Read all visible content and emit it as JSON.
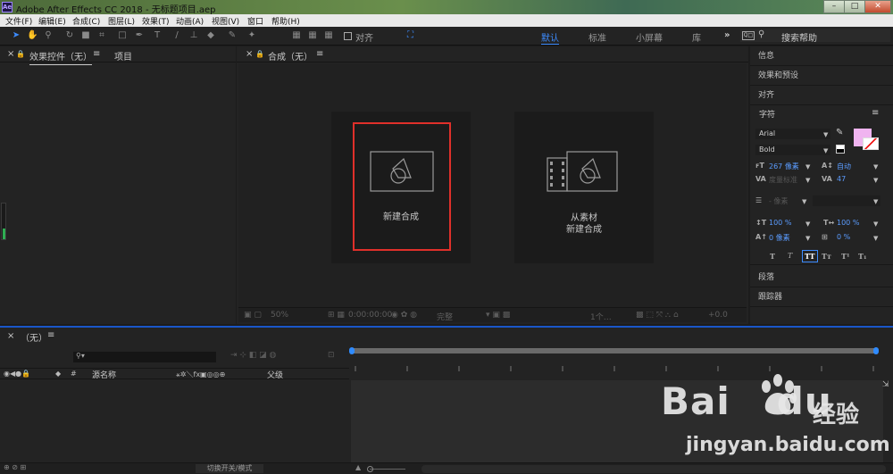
{
  "titlebar": {
    "logo": "Ae",
    "title": "Adobe After Effects CC 2018 - 无标题项目.aep",
    "buttons": [
      "–",
      "□",
      "✕"
    ]
  },
  "menu": [
    "文件(F)",
    "编辑(E)",
    "合成(C)",
    "图层(L)",
    "效果(T)",
    "动画(A)",
    "视图(V)",
    "窗口",
    "帮助(H)"
  ],
  "toolbar": {
    "align_label": "对齐",
    "workspaces": [
      "默认",
      "标准",
      "小屏幕",
      "库"
    ],
    "more": "»",
    "search_toggle": "Q□",
    "search_placeholder": "搜索帮助"
  },
  "left_panel": {
    "close": "×",
    "lock": "🔒",
    "tab_effects": "效果控件（无）",
    "menu": "≡",
    "tab_project": "项目"
  },
  "comp_panel": {
    "close": "×",
    "lock": "🔒",
    "tab_label": "合成（无）",
    "menu": "≡",
    "new_comp_label": "新建合成",
    "from_footage_line1": "从素材",
    "from_footage_line2": "新建合成",
    "footer": {
      "zoom": "50%",
      "timecode": "0:00:00:00",
      "quality": "完整",
      "views": "1个…",
      "exposure": "+0.0"
    }
  },
  "right_panel": {
    "sections_top": [
      "信息",
      "效果和预设",
      "对齐"
    ],
    "character_title": "字符",
    "character_menu": "≡",
    "font_name": "Arial",
    "font_style": "Bold",
    "font_size": "267 像素",
    "leading": "自动",
    "kerning": "度量标准",
    "tracking": "47",
    "stroke_width": "- 像素",
    "vscale": "100 %",
    "hscale": "100 %",
    "baseline": "0 像素",
    "tsume": "0 %",
    "styles": [
      "T",
      "T",
      "TT",
      "Tт",
      "T¹",
      "T₁"
    ],
    "sections_bottom": [
      "段落",
      "跟踪器"
    ],
    "fill_color": "#f0b4f0"
  },
  "timeline": {
    "close": "×",
    "title": "（无）",
    "menu": "≡",
    "search_icon": "⚲▾",
    "col_number": "#",
    "col_source": "源名称",
    "col_parent": "父级",
    "switch_mode": "切换开关/模式"
  },
  "watermark": {
    "logo_text": "Bai du",
    "cn_text": "经验",
    "url": "jingyan.baidu.com"
  }
}
